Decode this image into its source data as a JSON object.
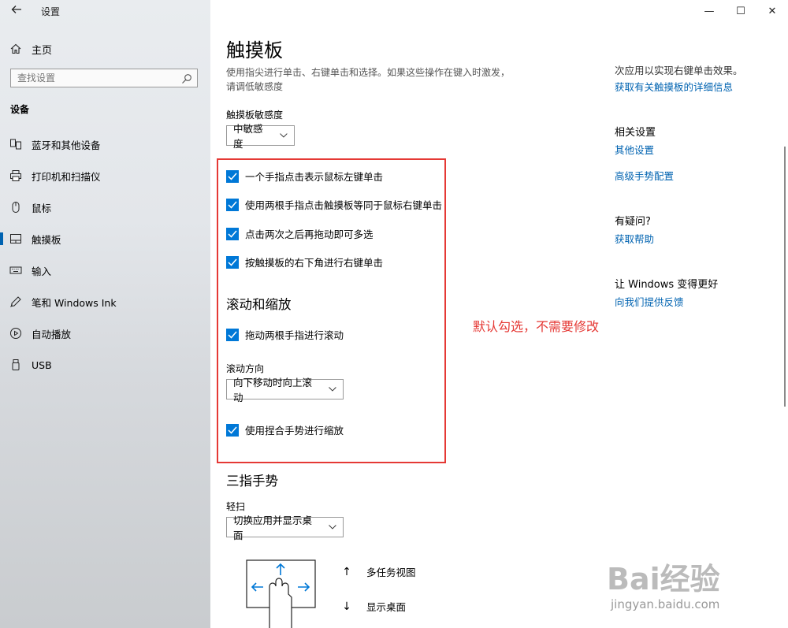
{
  "window": {
    "app_title": "设置",
    "back_icon": "back-arrow-icon",
    "minimize": "—",
    "maximize": "☐",
    "close": "✕"
  },
  "sidebar": {
    "home_label": "主页",
    "search_placeholder": "查找设置",
    "section": "设备",
    "items": [
      {
        "label": "蓝牙和其他设备",
        "icon": "bluetooth-device-icon"
      },
      {
        "label": "打印机和扫描仪",
        "icon": "printer-icon"
      },
      {
        "label": "鼠标",
        "icon": "mouse-icon"
      },
      {
        "label": "触摸板",
        "icon": "touchpad-icon",
        "active": true
      },
      {
        "label": "输入",
        "icon": "keyboard-icon"
      },
      {
        "label": "笔和 Windows Ink",
        "icon": "pen-icon"
      },
      {
        "label": "自动播放",
        "icon": "autoplay-icon"
      },
      {
        "label": "USB",
        "icon": "usb-icon"
      }
    ]
  },
  "main": {
    "title": "触摸板",
    "description": "使用指尖进行单击、右键单击和选择。如果这些操作在键入时激发，请调低敏感度",
    "sensitivity_label": "触摸板敏感度",
    "sensitivity_value": "中敏感度",
    "checkboxes_taps": [
      {
        "label": "一个手指点击表示鼠标左键单击",
        "checked": true
      },
      {
        "label": "使用两根手指点击触摸板等同于鼠标右键单击",
        "checked": true
      },
      {
        "label": "点击两次之后再拖动即可多选",
        "checked": true
      },
      {
        "label": "按触摸板的右下角进行右键单击",
        "checked": true
      }
    ],
    "scroll_heading": "滚动和缩放",
    "scroll_checkbox": {
      "label": "拖动两根手指进行滚动",
      "checked": true
    },
    "scroll_direction_label": "滚动方向",
    "scroll_direction_value": "向下移动时向上滚动",
    "zoom_checkbox": {
      "label": "使用捏合手势进行缩放",
      "checked": true
    },
    "three_finger_heading": "三指手势",
    "swipe_label": "轻扫",
    "swipe_value": "切换应用并显示桌面",
    "gesture_up": "多任务视图",
    "gesture_down": "显示桌面",
    "annotation": "默认勾选，不需要修改"
  },
  "right": {
    "top_text": "次应用以实现右键单击效果。",
    "top_link": "获取有关触摸板的详细信息",
    "related_heading": "相关设置",
    "related_links": [
      "其他设置",
      "高级手势配置"
    ],
    "question_heading": "有疑问?",
    "help_link": "获取帮助",
    "improve_heading": "让 Windows 变得更好",
    "feedback_link": "向我们提供反馈"
  },
  "watermark": {
    "brand": "Bai经验",
    "url": "jingyan.baidu.com"
  },
  "colors": {
    "accent": "#0078d7",
    "link": "#0063b1",
    "annotation": "#e53935"
  }
}
